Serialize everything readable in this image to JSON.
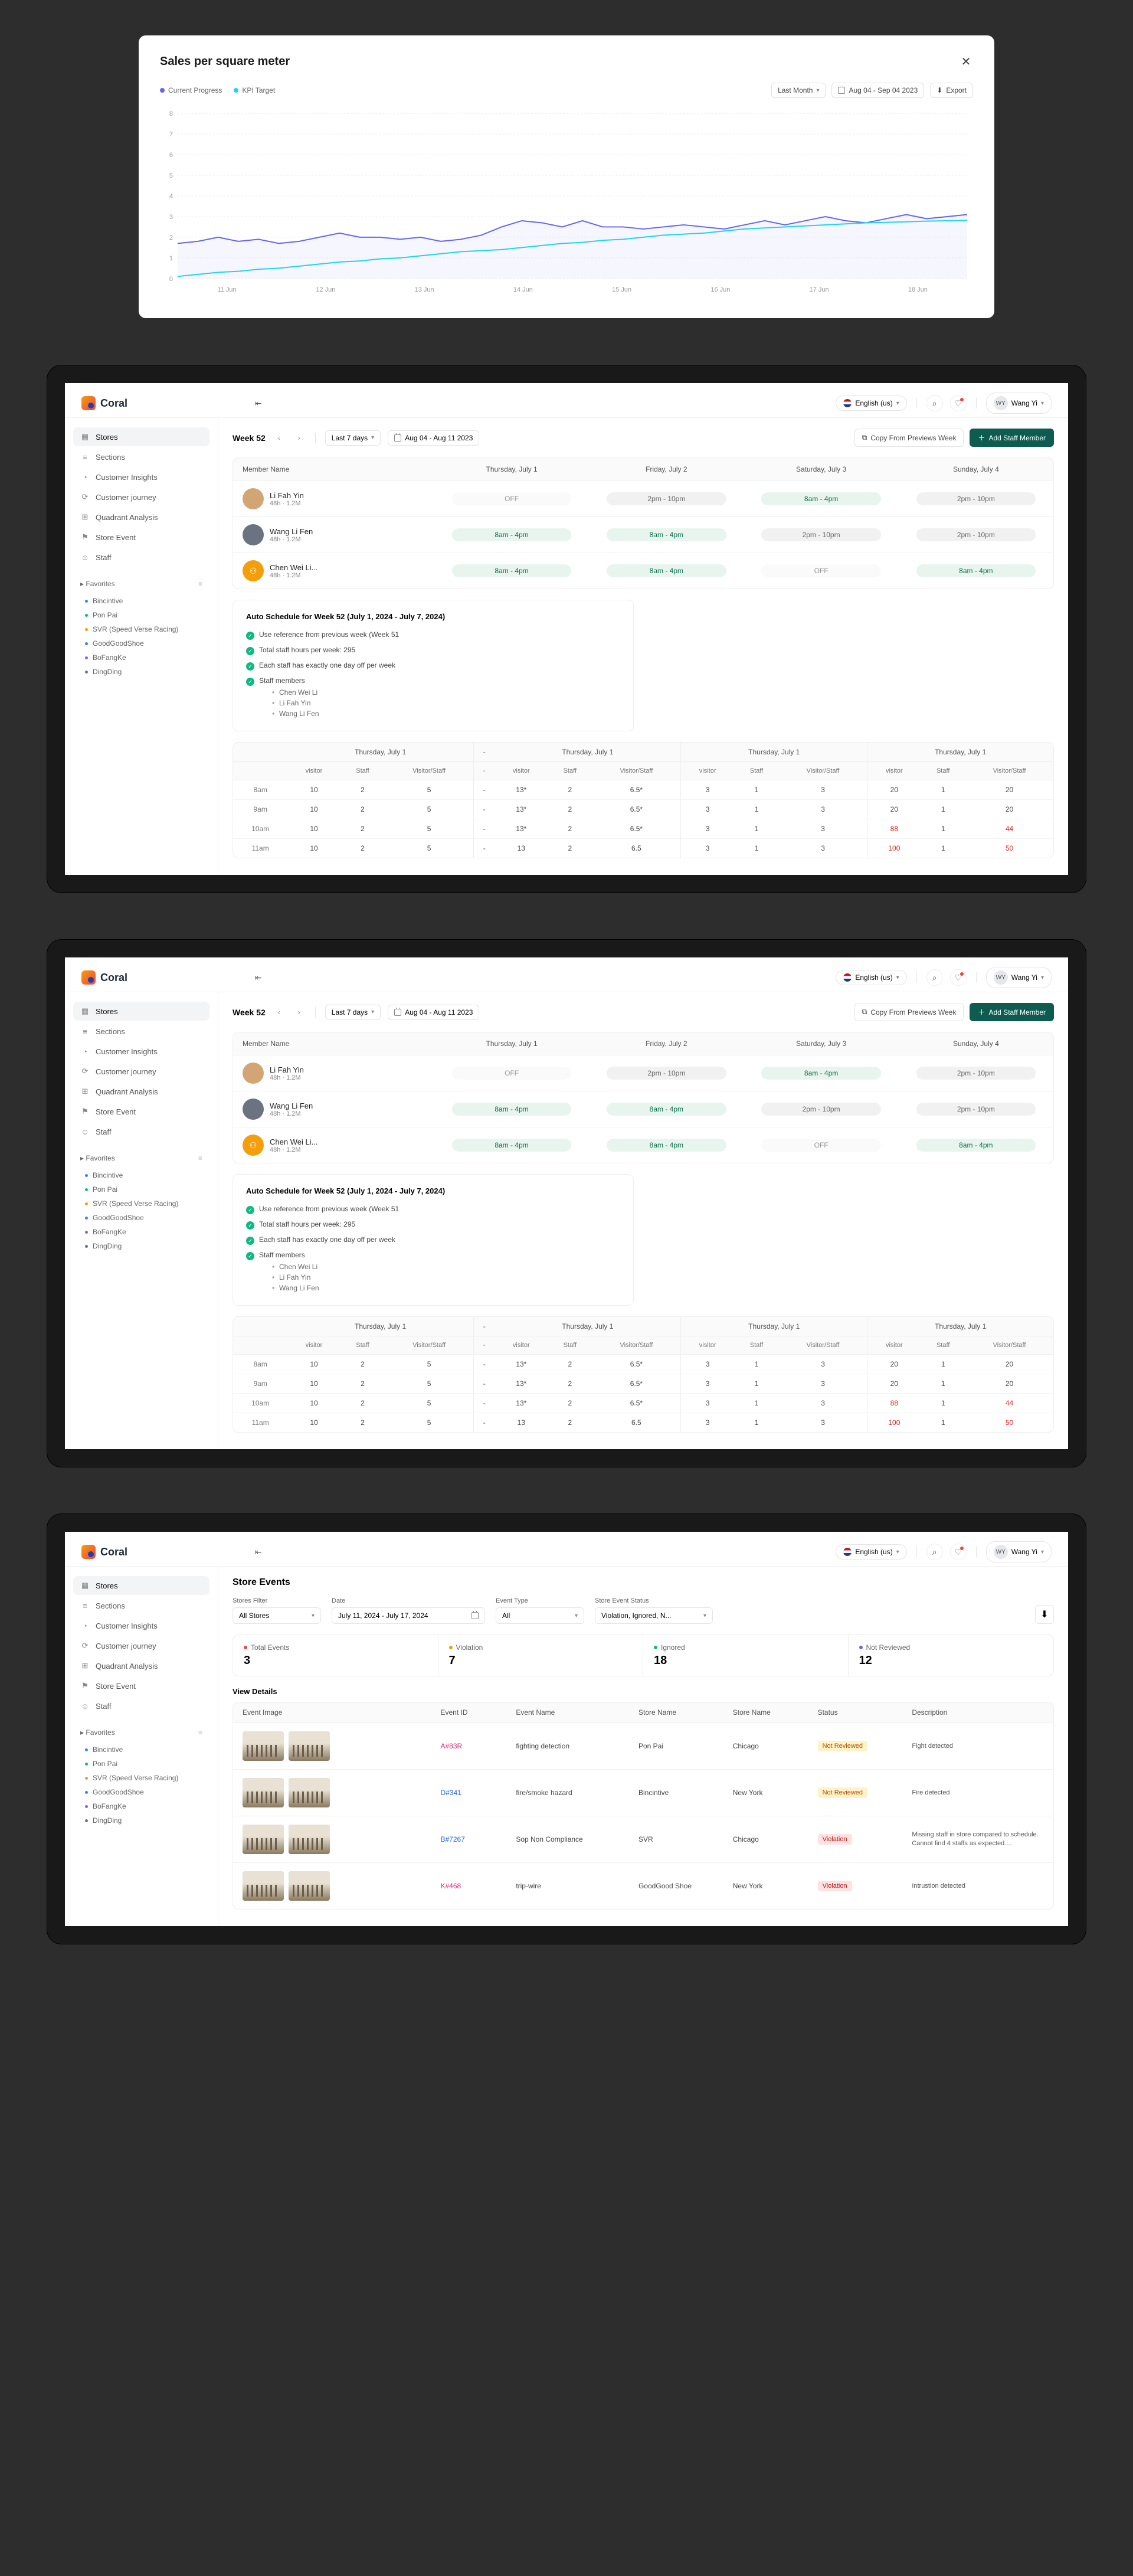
{
  "chart_data": {
    "type": "line",
    "title": "Sales per square meter",
    "legend": [
      "Current Progress",
      "KPI Target"
    ],
    "controls": {
      "range": "Last Month",
      "dates": "Aug 04 - Sep 04 2023",
      "export": "Export"
    },
    "ylim": [
      0,
      8
    ],
    "yticks": [
      0,
      1,
      2,
      3,
      4,
      5,
      6,
      7,
      8
    ],
    "categories": [
      "11 Jun",
      "12 Jun",
      "13 Jun",
      "14 Jun",
      "15 Jun",
      "16 Jun",
      "17 Jun",
      "18 Jun"
    ],
    "series": [
      {
        "name": "Current Progress",
        "color": "#6366f1",
        "values": [
          1.7,
          1.8,
          2.0,
          1.8,
          1.9,
          1.7,
          1.8,
          2.0,
          2.2,
          2.0,
          2.0,
          1.9,
          2.0,
          1.8,
          1.9,
          2.1,
          2.5,
          2.8,
          2.7,
          2.5,
          2.8,
          2.5,
          2.5,
          2.4,
          2.5,
          2.6,
          2.5,
          2.4,
          2.6,
          2.8,
          2.6,
          2.8,
          3.0,
          2.8,
          2.7,
          2.9,
          3.1,
          2.9,
          3.0,
          3.1
        ]
      },
      {
        "name": "KPI Target",
        "color": "#22d3ee",
        "values": [
          0.1,
          0.2,
          0.3,
          0.35,
          0.45,
          0.5,
          0.6,
          0.7,
          0.8,
          0.85,
          0.95,
          1.0,
          1.1,
          1.2,
          1.3,
          1.35,
          1.4,
          1.5,
          1.6,
          1.7,
          1.75,
          1.85,
          1.9,
          2.0,
          2.1,
          2.15,
          2.2,
          2.3,
          2.4,
          2.45,
          2.5,
          2.55,
          2.6,
          2.65,
          2.7,
          2.72,
          2.75,
          2.78,
          2.8,
          2.82
        ]
      }
    ]
  },
  "brand": "Coral",
  "lang": "English (us)",
  "user_initials": "WY",
  "user_name": "Wang Yi",
  "nav": [
    {
      "label": "Stores"
    },
    {
      "label": "Sections"
    },
    {
      "label": "Customer Insights"
    },
    {
      "label": "Customer journey"
    },
    {
      "label": "Quadrant Analysis"
    },
    {
      "label": "Store Event"
    },
    {
      "label": "Staff"
    }
  ],
  "favorites_label": "Favorites",
  "favorites": [
    {
      "label": "Bincintive",
      "color": "#3b82f6"
    },
    {
      "label": "Pon Pai",
      "color": "#10b981"
    },
    {
      "label": "SVR (Speed Verse Racing)",
      "color": "#f59e0b"
    },
    {
      "label": "GoodGoodShoe",
      "color": "#3b82f6"
    },
    {
      "label": "BoFangKe",
      "color": "#8b5cf6"
    },
    {
      "label": "DingDing",
      "color": "#6b7280"
    }
  ],
  "schedule": {
    "week": "Week 52",
    "range_sel": "Last 7 days",
    "date_range": "Aug 04 - Aug 11 2023",
    "copy_label": "Copy From Previews Week",
    "add_label": "Add Staff Member",
    "cols": [
      "Member Name",
      "Thursday, July 1",
      "Friday, July 2",
      "Saturday, July 3",
      "Sunday, July 4"
    ],
    "rows": [
      {
        "name": "Li Fah Yin",
        "sub": "48h · 1.2M",
        "shifts": [
          "OFF",
          "2pm - 10pm",
          "8am - 4pm",
          "2pm - 10pm"
        ],
        "styles": [
          "off",
          "grey",
          "green",
          "grey"
        ]
      },
      {
        "name": "Wang Li Fen",
        "sub": "48h · 1.2M",
        "shifts": [
          "8am - 4pm",
          "8am - 4pm",
          "2pm - 10pm",
          "2pm - 10pm"
        ],
        "styles": [
          "green",
          "green",
          "grey",
          "grey"
        ]
      },
      {
        "name": "Chen Wei Li...",
        "sub": "48h · 1.2M",
        "shifts": [
          "8am - 4pm",
          "8am - 4pm",
          "OFF",
          "8am - 4pm"
        ],
        "styles": [
          "green",
          "green",
          "off",
          "green"
        ]
      }
    ]
  },
  "auto": {
    "title": "Auto Schedule for Week 52 (July 1, 2024 - July 7, 2024)",
    "checks": [
      "Use reference from previous week (Week 51",
      "Total staff hours per week: 295",
      "Each staff has exactly one day off per week"
    ],
    "members_label": "Staff members",
    "members": [
      "Chen Wei Li",
      "Li Fah Yin",
      "Wang Li Fen"
    ]
  },
  "detail": {
    "day_header": "Thursday, July 1",
    "sub_headers": [
      "visitor",
      "Staff",
      "Visitor/Staff"
    ],
    "divider": "-",
    "rows": [
      {
        "t": "8am",
        "g1": [
          "10",
          "2",
          "5"
        ],
        "g2": [
          "13*",
          "2",
          "6.5*"
        ],
        "g3": [
          "3",
          "1",
          "3"
        ],
        "g4": [
          "20",
          "1",
          "20"
        ],
        "red": []
      },
      {
        "t": "9am",
        "g1": [
          "10",
          "2",
          "5"
        ],
        "g2": [
          "13*",
          "2",
          "6.5*"
        ],
        "g3": [
          "3",
          "1",
          "3"
        ],
        "g4": [
          "20",
          "1",
          "20"
        ],
        "red": []
      },
      {
        "t": "10am",
        "g1": [
          "10",
          "2",
          "5"
        ],
        "g2": [
          "13*",
          "2",
          "6.5*"
        ],
        "g3": [
          "3",
          "1",
          "3"
        ],
        "g4": [
          "88",
          "1",
          "44"
        ],
        "red": [
          "g4-0",
          "g4-2"
        ]
      },
      {
        "t": "11am",
        "g1": [
          "10",
          "2",
          "5"
        ],
        "g2": [
          "13",
          "2",
          "6.5"
        ],
        "g3": [
          "3",
          "1",
          "3"
        ],
        "g4": [
          "100",
          "1",
          "50"
        ],
        "red": [
          "g4-0",
          "g4-2"
        ]
      }
    ]
  },
  "events": {
    "page_title": "Store Events",
    "filters": {
      "stores_label": "Stores Filter",
      "stores_val": "All Stores",
      "date_label": "Date",
      "date_val": "July 11, 2024 - July 17, 2024",
      "type_label": "Event Type",
      "type_val": "All",
      "status_label": "Store Event Status",
      "status_val": "Violation, Ignored, N..."
    },
    "metrics": [
      {
        "label": "Total Events",
        "val": "3",
        "color": "#ef4444"
      },
      {
        "label": "Violation",
        "val": "7",
        "color": "#f59e0b"
      },
      {
        "label": "Ignored",
        "val": "18",
        "color": "#10b981"
      },
      {
        "label": "Not Reviewed",
        "val": "12",
        "color": "#6366f1"
      }
    ],
    "view_details": "View Details",
    "cols": [
      "Event Image",
      "Event ID",
      "Event Name",
      "Store Name",
      "Store Name",
      "Status",
      "Description"
    ],
    "rows": [
      {
        "id": "A#83R",
        "id_style": "pink",
        "name": "fighting detection",
        "store1": "Pon Pai",
        "store2": "Chicago",
        "status": "Not Reviewed",
        "status_style": "orange",
        "desc": "Fight detected"
      },
      {
        "id": "D#341",
        "id_style": "blue",
        "name": "fire/smoke hazard",
        "store1": "Bincintive",
        "store2": "New York",
        "status": "Not Reviewed",
        "status_style": "orange",
        "desc": "Fire detected"
      },
      {
        "id": "B#7267",
        "id_style": "blue",
        "name": "Sop Non Compliance",
        "store1": "SVR",
        "store2": "Chicago",
        "status": "Violation",
        "status_style": "red",
        "desc": "Missing staff in store compared to schedule. Cannot find 4 staffs as expected...."
      },
      {
        "id": "K#468",
        "id_style": "pink",
        "name": "trip-wire",
        "store1": "GoodGood Shoe",
        "store2": "New York",
        "status": "Violation",
        "status_style": "red",
        "desc": "Intrustion detected"
      }
    ]
  }
}
